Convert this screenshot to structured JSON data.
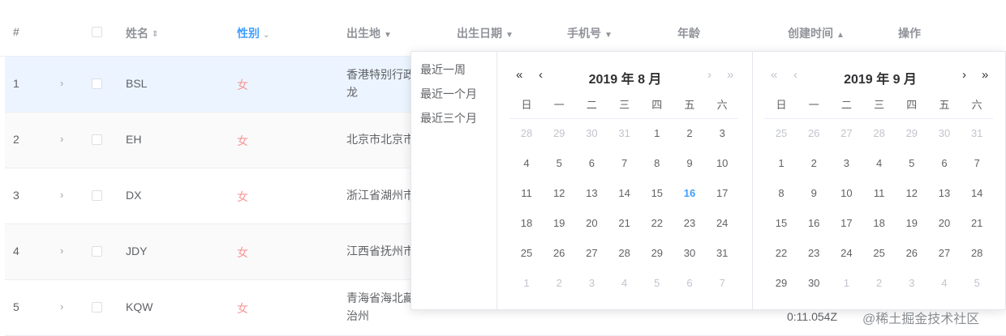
{
  "table": {
    "headers": {
      "index": "#",
      "name": "姓名",
      "gender": "性别",
      "birthplace": "出生地",
      "birthdate": "出生日期",
      "phone": "手机号",
      "age": "年龄",
      "created": "创建时间",
      "actions": "操作"
    },
    "rows": [
      {
        "index": "1",
        "name": "BSL",
        "gender": "女",
        "place_line1": "香港特别行政",
        "place_line2": "龙"
      },
      {
        "index": "2",
        "name": "EH",
        "gender": "女",
        "place_line1": "北京市北京市",
        "place_line2": ""
      },
      {
        "index": "3",
        "name": "DX",
        "gender": "女",
        "place_line1": "浙江省湖州市",
        "place_line2": ""
      },
      {
        "index": "4",
        "name": "JDY",
        "gender": "女",
        "place_line1": "江西省抚州市",
        "place_line2": ""
      },
      {
        "index": "5",
        "name": "KQW",
        "gender": "女",
        "place_line1": "青海省海北藏",
        "place_line2": "治州",
        "created_partial": "0:11.054Z"
      }
    ]
  },
  "picker": {
    "shortcuts": [
      "最近一周",
      "最近一个月",
      "最近三个月"
    ],
    "weekdays": [
      "日",
      "一",
      "二",
      "三",
      "四",
      "五",
      "六"
    ],
    "left": {
      "title": "2019 年 8 月",
      "days": [
        [
          [
            "28",
            1
          ],
          [
            "29",
            1
          ],
          [
            "30",
            1
          ],
          [
            "31",
            1
          ],
          [
            "1",
            0
          ],
          [
            "2",
            0
          ],
          [
            "3",
            0
          ]
        ],
        [
          [
            "4",
            0
          ],
          [
            "5",
            0
          ],
          [
            "6",
            0
          ],
          [
            "7",
            0
          ],
          [
            "8",
            0
          ],
          [
            "9",
            0
          ],
          [
            "10",
            0
          ]
        ],
        [
          [
            "11",
            0
          ],
          [
            "12",
            0
          ],
          [
            "13",
            0
          ],
          [
            "14",
            0
          ],
          [
            "15",
            0
          ],
          [
            "16",
            2
          ],
          [
            "17",
            0
          ]
        ],
        [
          [
            "18",
            0
          ],
          [
            "19",
            0
          ],
          [
            "20",
            0
          ],
          [
            "21",
            0
          ],
          [
            "22",
            0
          ],
          [
            "23",
            0
          ],
          [
            "24",
            0
          ]
        ],
        [
          [
            "25",
            0
          ],
          [
            "26",
            0
          ],
          [
            "27",
            0
          ],
          [
            "28",
            0
          ],
          [
            "29",
            0
          ],
          [
            "30",
            0
          ],
          [
            "31",
            0
          ]
        ],
        [
          [
            "1",
            1
          ],
          [
            "2",
            1
          ],
          [
            "3",
            1
          ],
          [
            "4",
            1
          ],
          [
            "5",
            1
          ],
          [
            "6",
            1
          ],
          [
            "7",
            1
          ]
        ]
      ]
    },
    "right": {
      "title": "2019 年 9 月",
      "days": [
        [
          [
            "25",
            1
          ],
          [
            "26",
            1
          ],
          [
            "27",
            1
          ],
          [
            "28",
            1
          ],
          [
            "29",
            1
          ],
          [
            "30",
            1
          ],
          [
            "31",
            1
          ]
        ],
        [
          [
            "1",
            0
          ],
          [
            "2",
            0
          ],
          [
            "3",
            0
          ],
          [
            "4",
            0
          ],
          [
            "5",
            0
          ],
          [
            "6",
            0
          ],
          [
            "7",
            0
          ]
        ],
        [
          [
            "8",
            0
          ],
          [
            "9",
            0
          ],
          [
            "10",
            0
          ],
          [
            "11",
            0
          ],
          [
            "12",
            0
          ],
          [
            "13",
            0
          ],
          [
            "14",
            0
          ]
        ],
        [
          [
            "15",
            0
          ],
          [
            "16",
            0
          ],
          [
            "17",
            0
          ],
          [
            "18",
            0
          ],
          [
            "19",
            0
          ],
          [
            "20",
            0
          ],
          [
            "21",
            0
          ]
        ],
        [
          [
            "22",
            0
          ],
          [
            "23",
            0
          ],
          [
            "24",
            0
          ],
          [
            "25",
            0
          ],
          [
            "26",
            0
          ],
          [
            "27",
            0
          ],
          [
            "28",
            0
          ]
        ],
        [
          [
            "29",
            0
          ],
          [
            "30",
            0
          ],
          [
            "1",
            1
          ],
          [
            "2",
            1
          ],
          [
            "3",
            1
          ],
          [
            "4",
            1
          ],
          [
            "5",
            1
          ]
        ]
      ]
    },
    "nav": {
      "double_left": "«",
      "left": "‹",
      "right": "›",
      "double_right": "»"
    }
  },
  "icons": {
    "sort": "sort-icon",
    "caret_down": "caret-down-icon",
    "caret_up": "caret-up-icon",
    "expand": "chevron-right-icon"
  },
  "watermark": "@稀土掘金技术社区",
  "colors": {
    "primary": "#409eff",
    "gender": "#f89898",
    "highlight_row": "#ecf5ff"
  }
}
